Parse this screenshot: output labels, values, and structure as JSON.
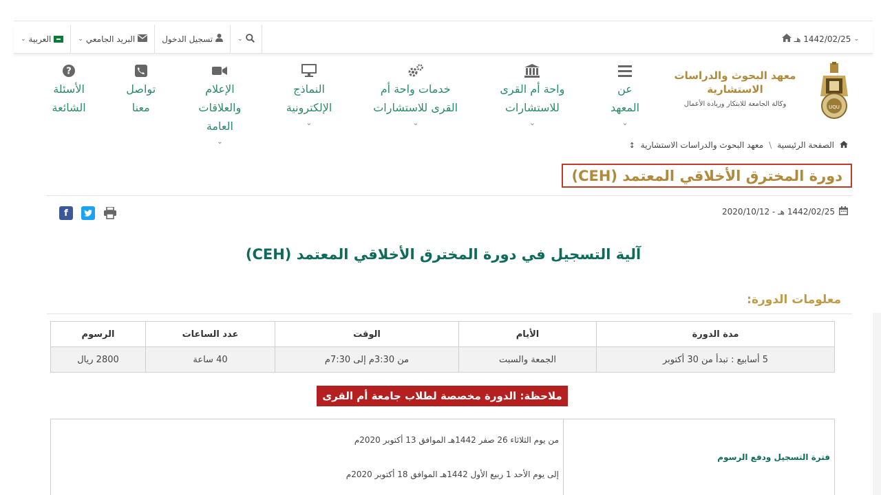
{
  "topbar": {
    "hijri_date": "1442/02/25 هـ",
    "language": "العربية",
    "university_mail": "البريد الجامعي",
    "login": "تسجيل الدخول"
  },
  "brand": {
    "name": "معهد البحوث والدراسات الاستشارية",
    "subtitle": "وكالة الجامعة للابتكار وريادة الأعمال"
  },
  "nav": [
    {
      "label": "عن المعهد",
      "icon": "menu-icon"
    },
    {
      "label": "واحة أم القرى للاستشارات",
      "icon": "building-icon"
    },
    {
      "label": "خدمات واحة أم القرى للاستشارات",
      "icon": "gears-icon"
    },
    {
      "label": "النماذج الإلكترونية",
      "icon": "monitor-icon"
    },
    {
      "label": "الإعلام والعلاقات العامة",
      "icon": "video-camera-icon"
    },
    {
      "label": "تواصل معنا",
      "icon": "phone-icon"
    },
    {
      "label": "الأسئلة الشائعة",
      "icon": "question-icon"
    }
  ],
  "breadcrumb": {
    "home": "الصفحة الرئيسية",
    "separator": "\\",
    "current": "معهد البحوث والدراسات الاستشارية"
  },
  "page_title": "دورة المخترق الأخلاقي المعتمد (CEH)",
  "post_date": "1442/02/25 هـ - 2020/10/12",
  "headline": "آلية التسجيل في دورة المخترق الأخلاقي المعتمد (CEH)",
  "info_heading": "معلومات الدورة:",
  "info_table": {
    "headers": [
      "مدة الدورة",
      "الأيام",
      "الوقت",
      "عدد الساعات",
      "الرسوم"
    ],
    "row": [
      "5 أسابيع : تبدأ من 30 أكتوبر",
      "الجمعة والسبت",
      "من 3:30م إلى 7:30م",
      "40 ساعة",
      "2800 ريال"
    ]
  },
  "note": "ملاحظة: الدورة مخصصة لطلاب جامعة أم القرى",
  "registration": {
    "label": "فترة التسجيل ودفع الرسوم",
    "from": "من يوم الثلاثاء 26 صفر 1442هـ الموافق  13 أكتوبر 2020م",
    "to": "إلى يوم الأحد 1 ربيع الأول 1442هـ الموافق  18 أكتوبر 2020م"
  },
  "colors": {
    "brand_green": "#2c8a6c",
    "gold": "#b08a3a",
    "alert_red": "#b3201f"
  }
}
